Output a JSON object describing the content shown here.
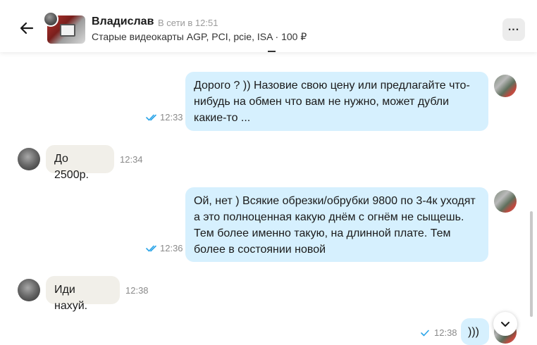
{
  "header": {
    "name": "Владислав",
    "status": "В сети в 12:51",
    "listing": "Старые видеокарты AGP, PCI, pcie, ISA · 100 ₽"
  },
  "messages": [
    {
      "direction": "out",
      "text": "Дорого ? )) Назовие свою цену или предлагайте что-нибудь на обмен что вам не  нужно, может дубли какие-то ...",
      "time": "12:33",
      "read": true
    },
    {
      "direction": "in",
      "text": "До 2500р.",
      "time": "12:34"
    },
    {
      "direction": "out",
      "text": "Ой, нет ) Всякие обрезки/обрубки 9800 по 3-4к уходят а это полноценная какую днём с огнём не сыщешь. Тем более именно такую, на длинной плате. Тем более в состоянии новой",
      "time": "12:36",
      "read": true
    },
    {
      "direction": "in",
      "text": "Иди нахуй.",
      "time": "12:38"
    },
    {
      "direction": "out",
      "text": ")))",
      "time": "12:38",
      "read": false
    }
  ],
  "icons": {
    "back": "arrow-left-icon",
    "menu": "more-horizontal-icon",
    "read": "double-check-icon",
    "sent": "single-check-icon",
    "scroll_down": "chevron-down-icon"
  },
  "colors": {
    "outgoing_bubble": "#d6f0fe",
    "incoming_bubble": "#f1efe9",
    "check": "#2aa4e8"
  }
}
